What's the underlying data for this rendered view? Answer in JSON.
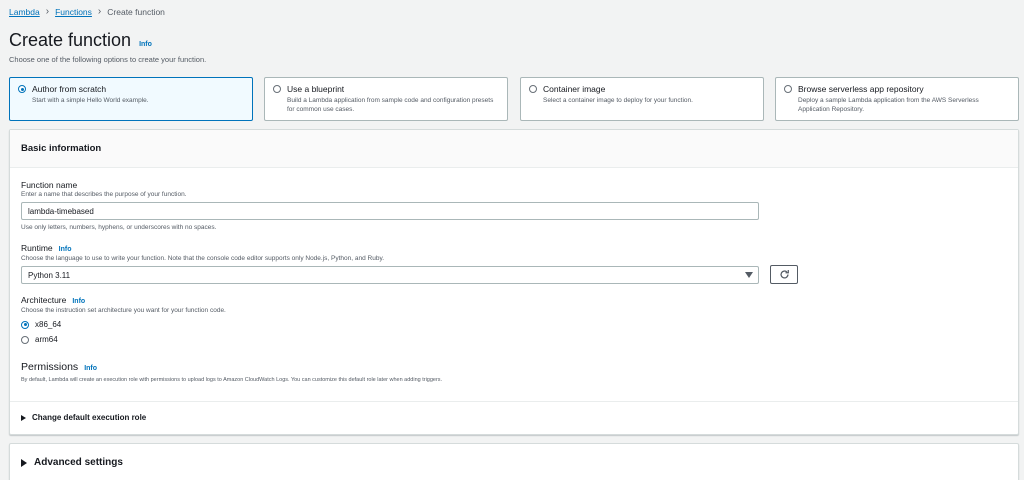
{
  "breadcrumb": {
    "items": [
      "Lambda",
      "Functions"
    ],
    "current": "Create function"
  },
  "page": {
    "title": "Create function",
    "info": "Info",
    "subtitle": "Choose one of the following options to create your function."
  },
  "options": [
    {
      "label": "Author from scratch",
      "desc": "Start with a simple Hello World example.",
      "selected": true
    },
    {
      "label": "Use a blueprint",
      "desc": "Build a Lambda application from sample code and configuration presets for common use cases.",
      "selected": false
    },
    {
      "label": "Container image",
      "desc": "Select a container image to deploy for your function.",
      "selected": false
    },
    {
      "label": "Browse serverless app repository",
      "desc": "Deploy a sample Lambda application from the AWS Serverless Application Repository.",
      "selected": false
    }
  ],
  "basic": {
    "title": "Basic information",
    "function_name": {
      "label": "Function name",
      "desc": "Enter a name that describes the purpose of your function.",
      "value": "lambda-timebased",
      "constraint": "Use only letters, numbers, hyphens, or underscores with no spaces."
    },
    "runtime": {
      "label": "Runtime",
      "info": "Info",
      "desc": "Choose the language to use to write your function. Note that the console code editor supports only Node.js, Python, and Ruby.",
      "value": "Python 3.11"
    },
    "architecture": {
      "label": "Architecture",
      "info": "Info",
      "desc": "Choose the instruction set architecture you want for your function code.",
      "options": [
        "x86_64",
        "arm64"
      ],
      "selected": "x86_64"
    },
    "permissions": {
      "label": "Permissions",
      "info": "Info",
      "desc": "By default, Lambda will create an execution role with permissions to upload logs to Amazon CloudWatch Logs. You can customize this default role later when adding triggers."
    },
    "change_role": "Change default execution role"
  },
  "advanced": {
    "title": "Advanced settings"
  },
  "colors": {
    "link": "#0073bb",
    "selected_bg": "#f1faff"
  }
}
